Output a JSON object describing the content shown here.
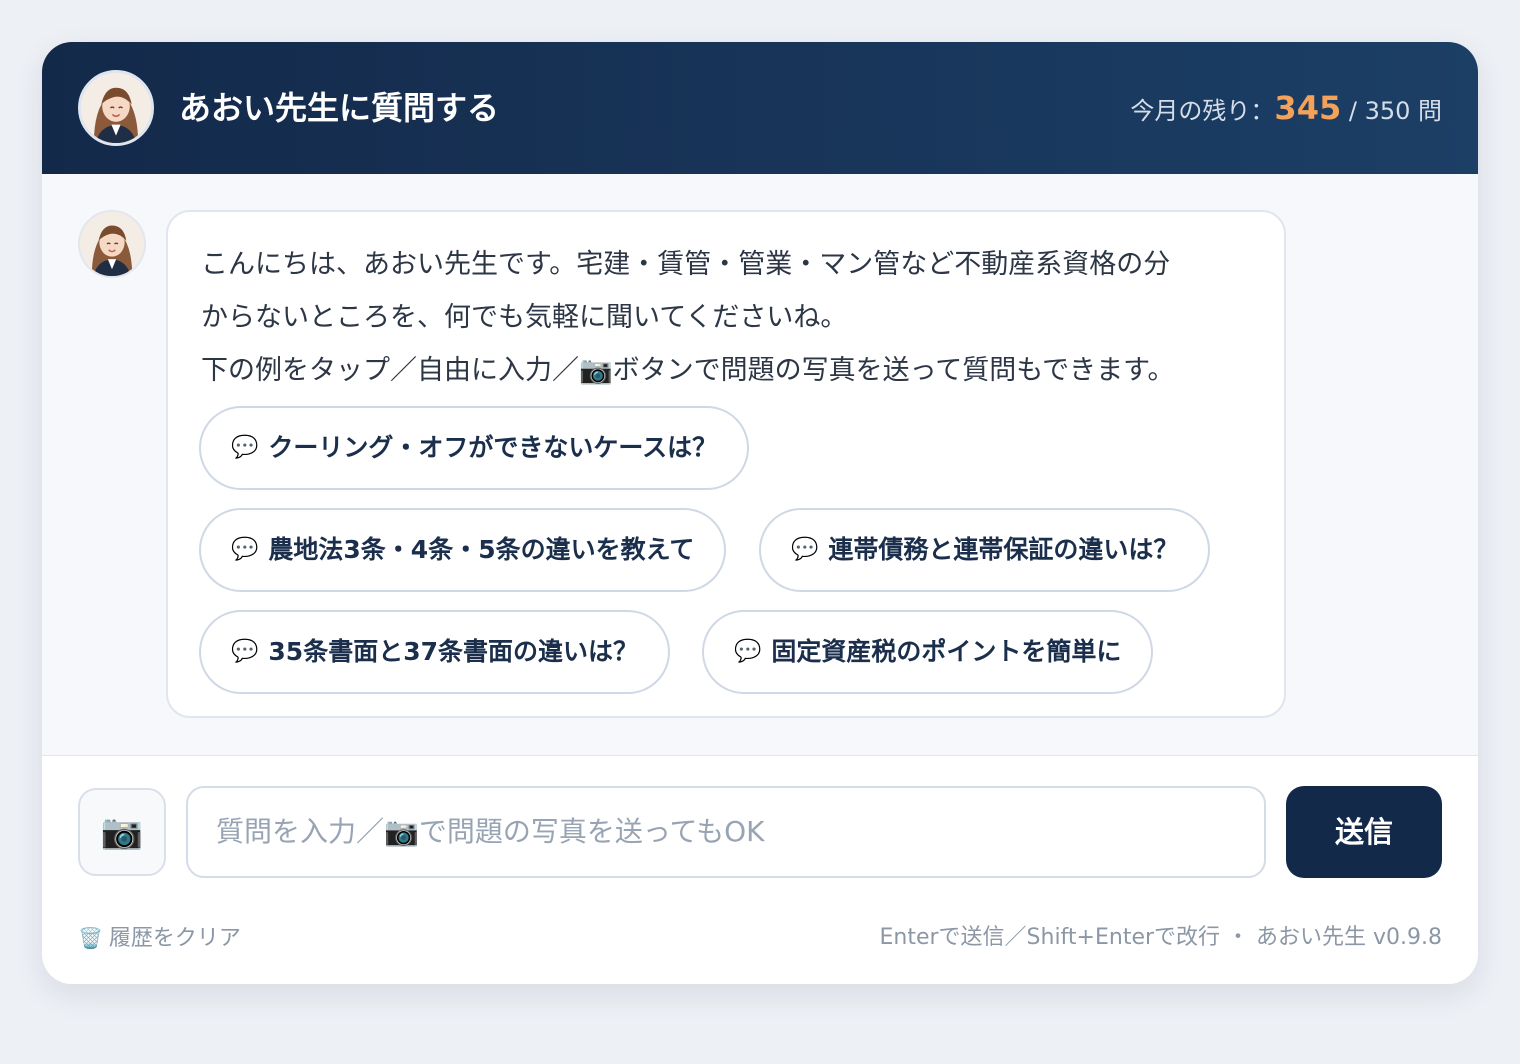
{
  "header": {
    "title": "あおい先生に質問する",
    "quota_label": "今月の残り：",
    "quota_remaining": "345",
    "quota_total": " / 350 問"
  },
  "message": {
    "lines": [
      "こんにちは、あおい先生です。宅建・賃管・管業・マン管など不動産系資格の分",
      "からないところを、何でも気軽に聞いてくださいね。",
      "下の例をタップ／自由に入力／📷ボタンで問題の写真を送って質問もできます。"
    ]
  },
  "suggestions": [
    {
      "icon": "💬",
      "label": "クーリング・オフができないケースは？"
    },
    {
      "icon": "💬",
      "label": "農地法3条・4条・5条の違いを教えて"
    },
    {
      "icon": "💬",
      "label": "連帯債務と連帯保証の違いは？"
    },
    {
      "icon": "💬",
      "label": "35条書面と37条書面の違いは？"
    },
    {
      "icon": "💬",
      "label": "固定資産税のポイントを簡単に"
    }
  ],
  "composer": {
    "camera_icon": "📷",
    "placeholder": "質問を入力／📷で問題の写真を送ってもOK",
    "send_label": "送信"
  },
  "footer": {
    "clear_icon": "🗑️",
    "clear_label": "履歴をクリア",
    "hint": "Enterで送信／Shift+Enterで改行 ・ あおい先生 v0.9.8"
  },
  "colors": {
    "header_bg": "#13294a",
    "accent_orange": "#f4a25a",
    "send_bg": "#13294a"
  }
}
